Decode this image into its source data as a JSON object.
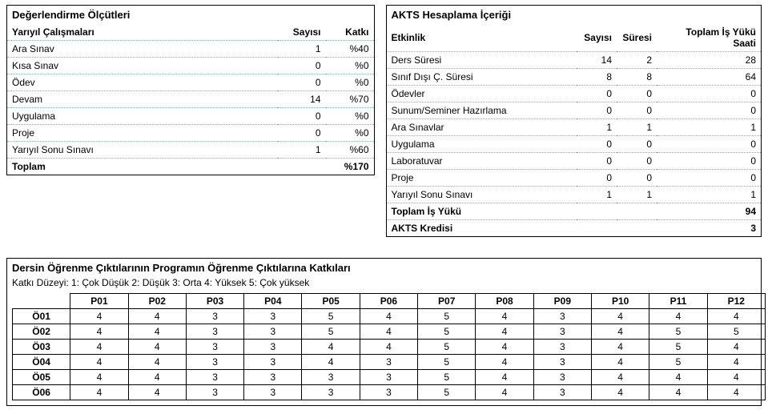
{
  "eval": {
    "title": "Değerlendirme Ölçütleri",
    "col_label": "Yarıyıl Çalışmaları",
    "col_count": "Sayısı",
    "col_weight": "Katkı",
    "rows": [
      {
        "label": "Ara Sınav",
        "count": "1",
        "weight": "%40"
      },
      {
        "label": "Kısa Sınav",
        "count": "0",
        "weight": "%0"
      },
      {
        "label": "Ödev",
        "count": "0",
        "weight": "%0"
      },
      {
        "label": "Devam",
        "count": "14",
        "weight": "%70"
      },
      {
        "label": "Uygulama",
        "count": "0",
        "weight": "%0"
      },
      {
        "label": "Proje",
        "count": "0",
        "weight": "%0"
      },
      {
        "label": "Yarıyıl Sonu Sınavı",
        "count": "1",
        "weight": "%60"
      }
    ],
    "total_label": "Toplam",
    "total_value": "%170"
  },
  "akts": {
    "title": "AKTS Hesaplama İçeriği",
    "col_activity": "Etkinlik",
    "col_count": "Sayısı",
    "col_duration": "Süresi",
    "col_total": "Toplam İş Yükü Saati",
    "rows": [
      {
        "label": "Ders Süresi",
        "count": "14",
        "dur": "2",
        "tot": "28"
      },
      {
        "label": "Sınıf Dışı Ç. Süresi",
        "count": "8",
        "dur": "8",
        "tot": "64"
      },
      {
        "label": "Ödevler",
        "count": "0",
        "dur": "0",
        "tot": "0"
      },
      {
        "label": "Sunum/Seminer Hazırlama",
        "count": "0",
        "dur": "0",
        "tot": "0"
      },
      {
        "label": "Ara Sınavlar",
        "count": "1",
        "dur": "1",
        "tot": "1"
      },
      {
        "label": "Uygulama",
        "count": "0",
        "dur": "0",
        "tot": "0"
      },
      {
        "label": "Laboratuvar",
        "count": "0",
        "dur": "0",
        "tot": "0"
      },
      {
        "label": "Proje",
        "count": "0",
        "dur": "0",
        "tot": "0"
      },
      {
        "label": "Yarıyıl Sonu Sınavı",
        "count": "1",
        "dur": "1",
        "tot": "1"
      }
    ],
    "total_load_label": "Toplam İş Yükü",
    "total_load_value": "94",
    "credit_label": "AKTS Kredisi",
    "credit_value": "3"
  },
  "matrix": {
    "title": "Dersin Öğrenme Çıktılarının Programın Öğrenme Çıktılarına Katkıları",
    "note": "Katkı Düzeyi: 1: Çok Düşük 2: Düşük 3: Orta 4: Yüksek 5: Çok yüksek",
    "cols": [
      "P01",
      "P02",
      "P03",
      "P04",
      "P05",
      "P06",
      "P07",
      "P08",
      "P09",
      "P10",
      "P11",
      "P12"
    ],
    "rows": [
      {
        "h": "Ö01",
        "v": [
          "4",
          "4",
          "3",
          "3",
          "5",
          "4",
          "5",
          "4",
          "3",
          "4",
          "4",
          "4"
        ]
      },
      {
        "h": "Ö02",
        "v": [
          "4",
          "4",
          "3",
          "3",
          "5",
          "4",
          "5",
          "4",
          "3",
          "4",
          "5",
          "5"
        ]
      },
      {
        "h": "Ö03",
        "v": [
          "4",
          "4",
          "3",
          "3",
          "4",
          "4",
          "5",
          "4",
          "3",
          "4",
          "5",
          "4"
        ]
      },
      {
        "h": "Ö04",
        "v": [
          "4",
          "4",
          "3",
          "3",
          "4",
          "3",
          "5",
          "4",
          "3",
          "4",
          "5",
          "4"
        ]
      },
      {
        "h": "Ö05",
        "v": [
          "4",
          "4",
          "3",
          "3",
          "3",
          "3",
          "5",
          "4",
          "3",
          "4",
          "4",
          "4"
        ]
      },
      {
        "h": "Ö06",
        "v": [
          "4",
          "4",
          "3",
          "3",
          "3",
          "3",
          "5",
          "4",
          "3",
          "4",
          "4",
          "4"
        ]
      }
    ]
  }
}
